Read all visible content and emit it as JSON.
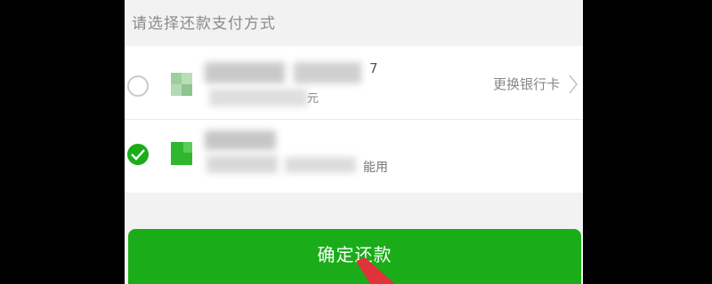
{
  "header": {
    "title": "请选择还款支付方式"
  },
  "options": [
    {
      "masked_suffix": "7",
      "sub_suffix": "元",
      "action_label": "更换银行卡",
      "selected": false
    },
    {
      "sub_suffix": "能用",
      "selected": true
    }
  ],
  "confirm": {
    "label": "确定还款"
  },
  "colors": {
    "accent": "#1aad19",
    "background": "#f2f2f2",
    "frame": "#000000"
  }
}
